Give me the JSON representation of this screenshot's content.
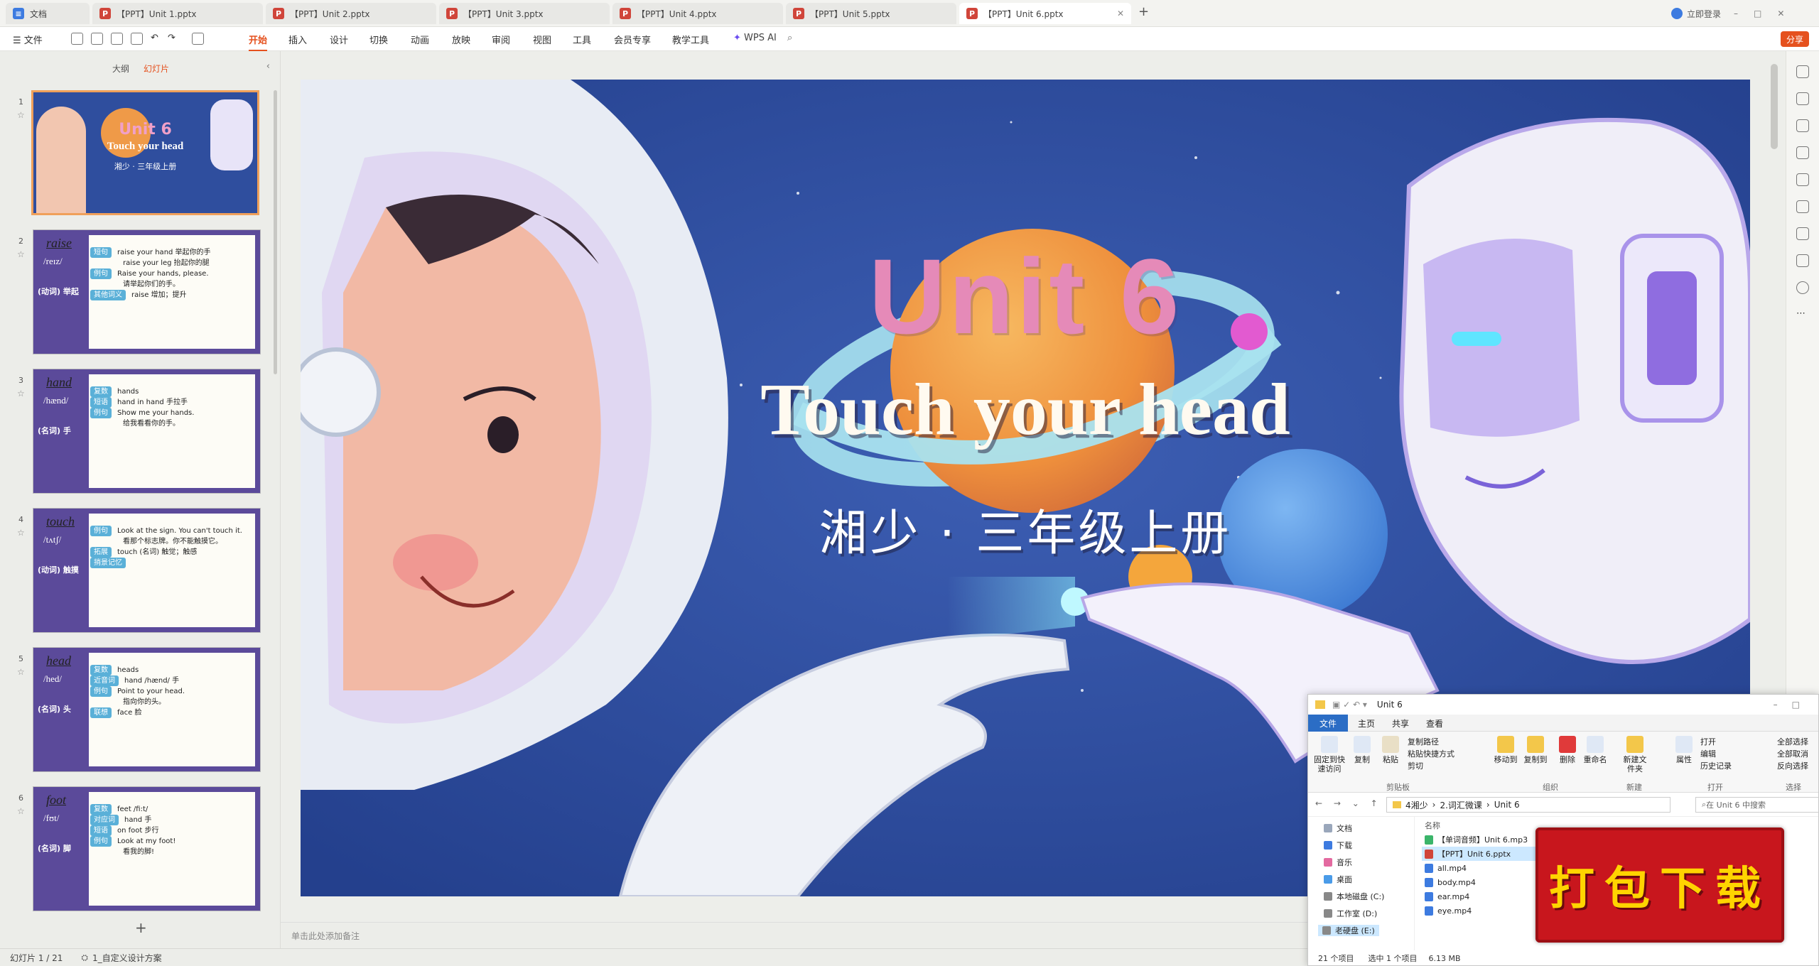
{
  "tabs": [
    {
      "label": "文档",
      "icon": "doc"
    },
    {
      "label": "【PPT】Unit 1.pptx",
      "icon": "ppt"
    },
    {
      "label": "【PPT】Unit 2.pptx",
      "icon": "ppt"
    },
    {
      "label": "【PPT】Unit 3.pptx",
      "icon": "ppt"
    },
    {
      "label": "【PPT】Unit 4.pptx",
      "icon": "ppt"
    },
    {
      "label": "【PPT】Unit 5.pptx",
      "icon": "ppt"
    },
    {
      "label": "【PPT】Unit 6.pptx",
      "icon": "ppt"
    }
  ],
  "new_tab": "+",
  "top_right": {
    "login": "立即登录",
    "share": "分享"
  },
  "menu": {
    "file": "文件",
    "items": [
      "开始",
      "插入",
      "设计",
      "切换",
      "动画",
      "放映",
      "审阅",
      "视图",
      "工具",
      "会员专享",
      "教学工具"
    ],
    "wps_ai": "WPS AI"
  },
  "panel": {
    "tab_outline": "大纲",
    "tab_slides": "幻灯片",
    "add": "+"
  },
  "thumbs": [
    {
      "num": "1",
      "kind": "cover",
      "title": "Unit 6",
      "sub": "Touch your head",
      "grade": "湘少 · 三年级上册"
    },
    {
      "num": "2",
      "kind": "word",
      "word": "raise",
      "phon": "/reɪz/",
      "pos": "(动词) 举起",
      "rows": [
        [
          "短句",
          "raise your hand 举起你的手"
        ],
        [
          "",
          "raise your leg 抬起你的腿"
        ],
        [
          "例句",
          "Raise your hands, please."
        ],
        [
          "",
          "请举起你们的手。"
        ],
        [
          "其他词义",
          "raise 增加；提升"
        ]
      ]
    },
    {
      "num": "3",
      "kind": "word",
      "word": "hand",
      "phon": "/hænd/",
      "pos": "(名词) 手",
      "rows": [
        [
          "复数",
          "hands"
        ],
        [
          "短语",
          "hand in hand 手拉手"
        ],
        [
          "例句",
          "Show me your hands."
        ],
        [
          "",
          "给我看看你的手。"
        ]
      ]
    },
    {
      "num": "4",
      "kind": "word",
      "word": "touch",
      "phon": "/tʌtʃ/",
      "pos": "(动词) 触摸",
      "rows": [
        [
          "例句",
          "Look at the sign. You can't touch it."
        ],
        [
          "",
          "看那个标志牌。你不能触摸它。"
        ],
        [
          "拓展",
          "touch (名词) 触觉；触感"
        ],
        [
          "捎景记忆",
          ""
        ]
      ]
    },
    {
      "num": "5",
      "kind": "word",
      "word": "head",
      "phon": "/hed/",
      "pos": "(名词) 头",
      "rows": [
        [
          "复数",
          "heads"
        ],
        [
          "近音词",
          "hand /hænd/ 手"
        ],
        [
          "例句",
          "Point to your head."
        ],
        [
          "",
          "指向你的头。"
        ],
        [
          "联想",
          "face 脸"
        ]
      ]
    },
    {
      "num": "6",
      "kind": "word",
      "word": "foot",
      "phon": "/fʊt/",
      "pos": "(名词) 脚",
      "rows": [
        [
          "复数",
          "feet /fi:t/"
        ],
        [
          "对应词",
          "hand 手"
        ],
        [
          "短语",
          "on foot 步行"
        ],
        [
          "例句",
          "Look at my foot!"
        ],
        [
          "",
          "看我的脚!"
        ]
      ]
    }
  ],
  "slide": {
    "title_unit": "Unit 6",
    "title_sub": "Touch your head",
    "grade": "湘少 · 三年级上册"
  },
  "notes_placeholder": "单击此处添加备注",
  "status": {
    "slide_pos": "幻灯片 1 / 21",
    "theme": "1_自定义设计方案"
  },
  "explorer": {
    "title": "Unit 6",
    "tabs": [
      "文件",
      "主页",
      "共享",
      "查看"
    ],
    "ribbon": {
      "pin": "固定到快速访问",
      "copy": "复制",
      "paste": "粘贴",
      "copy_path": "复制路径",
      "paste_shortcut": "粘贴快捷方式",
      "cut": "剪切",
      "move_to": "移动到",
      "copy_to": "复制到",
      "delete": "删除",
      "rename": "重命名",
      "new_folder": "新建文件夹",
      "properties": "属性",
      "open": "打开",
      "edit": "编辑",
      "history": "历史记录",
      "select_all": "全部选择",
      "select_none": "全部取消",
      "invert": "反向选择",
      "g_clipboard": "剪贴板",
      "g_organize": "组织",
      "g_new": "新建",
      "g_open": "打开",
      "g_select": "选择"
    },
    "path": [
      "4湘少",
      "2.词汇微课",
      "Unit 6"
    ],
    "search": "在 Unit 6 中搜索",
    "nav": [
      "文档",
      "下载",
      "音乐",
      "桌面",
      "本地磁盘 (C:)",
      "工作室 (D:)",
      "老硬盘 (E:)"
    ],
    "col_name": "名称",
    "files": [
      {
        "name": "【单词音频】Unit 6.mp3",
        "type": "audio"
      },
      {
        "name": "【PPT】Unit 6.pptx",
        "type": "ppt"
      },
      {
        "name": "all.mp4",
        "type": "video"
      },
      {
        "name": "body.mp4",
        "type": "video"
      },
      {
        "name": "ear.mp4",
        "type": "video"
      },
      {
        "name": "eye.mp4",
        "type": "video"
      }
    ],
    "status": {
      "count": "21 个项目",
      "selected": "选中 1 个项目",
      "size": "6.13 MB"
    }
  },
  "stamp": "打包下载",
  "colors": {
    "accent": "#e5511e",
    "slide_bg": "#2d4a9a",
    "planet_orange": "#f3a43b",
    "title_pink": "#e06aa0"
  }
}
